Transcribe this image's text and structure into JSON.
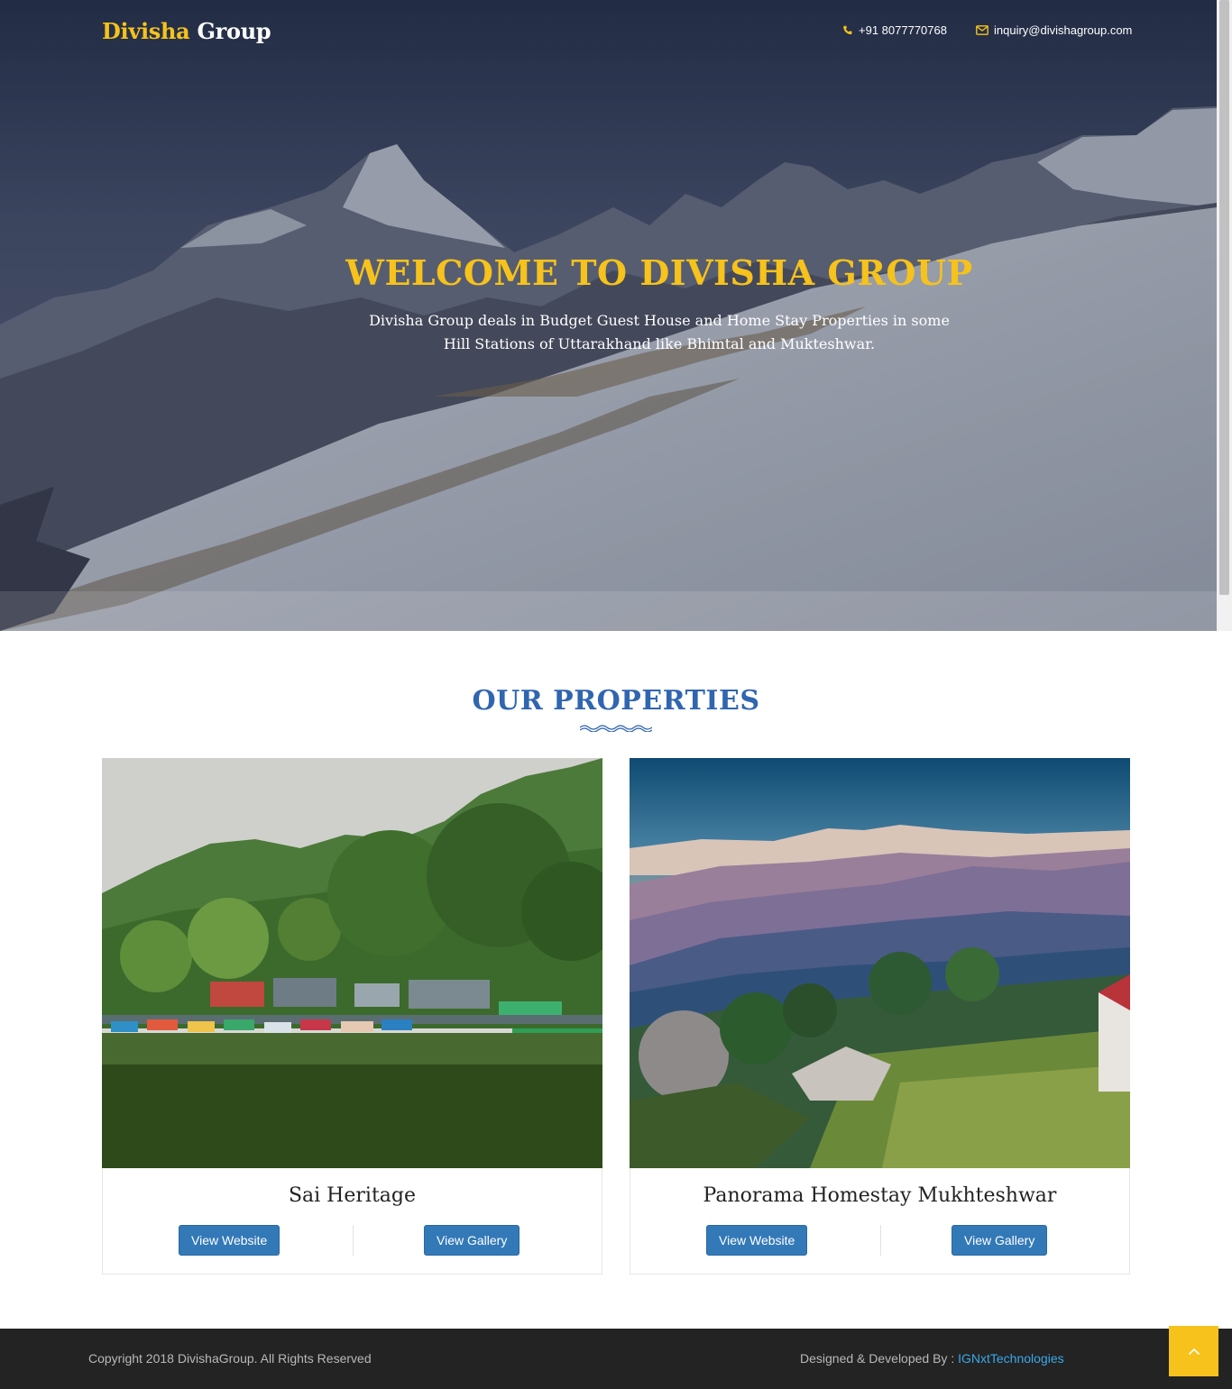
{
  "header": {
    "logo_part1": "Divisha",
    "logo_part2": "Group",
    "phone": "+91 8077770768",
    "email": "inquiry@divishagroup.com"
  },
  "hero": {
    "title": "WELCOME TO DIVISHA GROUP",
    "subtitle": "Divisha Group deals in Budget Guest House and Home Stay Properties in some Hill Stations of Uttarakhand like Bhimtal and Mukteshwar."
  },
  "properties": {
    "title": "OUR PROPERTIES",
    "items": [
      {
        "name": "Sai Heritage",
        "website_label": "View Website",
        "gallery_label": "View Gallery"
      },
      {
        "name": "Panorama Homestay Mukhteshwar",
        "website_label": "View Website",
        "gallery_label": "View Gallery"
      }
    ]
  },
  "footer": {
    "copyright": "Copyright 2018 DivishaGroup. All Rights Reserved",
    "credit_prefix": "Designed & Developed By :",
    "credit_link": "IGNxtTechnologies"
  },
  "icons": {
    "phone": "phone-icon",
    "email": "envelope-icon",
    "back_to_top": "chevron-up-icon"
  },
  "colors": {
    "accent_yellow": "#f6c21b",
    "title_blue": "#3066b0",
    "button_blue": "#3379b8",
    "footer_bg": "#232323",
    "link_blue": "#3aa8e8"
  }
}
